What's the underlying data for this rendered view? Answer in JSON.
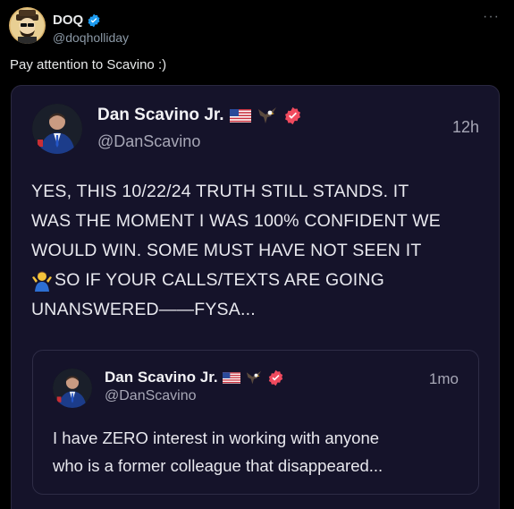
{
  "post": {
    "author_name": "DOQ",
    "author_handle": "@doqholliday",
    "more_label": "···",
    "text": "Pay attention to Scavino :)"
  },
  "card": {
    "author_name": "Dan Scavino Jr.",
    "author_handle": "@DanScavino",
    "time": "12h",
    "body_lines": [
      "YES, THIS 10/22/24 TRUTH STILL STANDS. IT",
      "WAS THE MOMENT I WAS 100% CONFIDENT WE",
      "WOULD WIN. SOME MUST HAVE NOT SEEN IT",
      "SO IF YOUR CALLS/TEXTS ARE GOING",
      "UNANSWERED——FYSA..."
    ]
  },
  "quote": {
    "author_name": "Dan Scavino Jr.",
    "author_handle": "@DanScavino",
    "time": "1mo",
    "body_lines": [
      "I have ZERO interest in working with anyone",
      "who is a former colleague that disappeared..."
    ]
  },
  "colors": {
    "verified_blue": "#1d9bf0",
    "truth_badge_red": "#f04a5e",
    "card_bg": "#15132a"
  },
  "icons": {
    "verified": "verified-badge-icon",
    "flag": "us-flag-emoji",
    "eagle": "eagle-emoji",
    "shrug": "person-shrugging-emoji",
    "truth_verified": "truth-verified-badge-icon"
  }
}
